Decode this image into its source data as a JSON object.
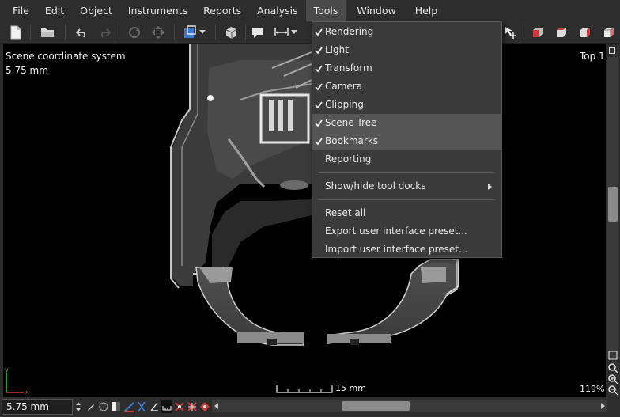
{
  "menubar": {
    "items": [
      {
        "label": "File"
      },
      {
        "label": "Edit"
      },
      {
        "label": "Object"
      },
      {
        "label": "Instruments"
      },
      {
        "label": "Reports"
      },
      {
        "label": "Analysis"
      },
      {
        "label": "Tools",
        "active": true
      },
      {
        "label": "Window"
      },
      {
        "label": "Help"
      }
    ]
  },
  "tools_menu": {
    "items": [
      {
        "label": "Rendering",
        "checked": true
      },
      {
        "label": "Light",
        "checked": true
      },
      {
        "label": "Transform",
        "checked": true
      },
      {
        "label": "Camera",
        "checked": true
      },
      {
        "label": "Clipping",
        "checked": true
      },
      {
        "label": "Scene Tree",
        "checked": true,
        "highlighted": true
      },
      {
        "label": "Bookmarks",
        "checked": true,
        "highlighted": true
      },
      {
        "label": "Reporting",
        "checked": false
      },
      {
        "label": "Show/hide tool docks",
        "submenu": true
      },
      {
        "label": "Reset all"
      },
      {
        "label": "Export user interface preset..."
      },
      {
        "label": "Import user interface preset..."
      }
    ]
  },
  "viewport": {
    "coord_system_label": "Scene coordinate system",
    "voxel_size": "5.75 mm",
    "view_label": "Top 1",
    "scale_bar_label": "15 mm",
    "zoom_percent": "119%"
  },
  "statusbar": {
    "zoom_field_value": "5.75 mm"
  },
  "colors": {
    "menu_bg": "#2d2d2d",
    "dropdown_bg": "#3a3a3a",
    "highlight": "#555555",
    "accent_blue": "#3a7bd5"
  }
}
